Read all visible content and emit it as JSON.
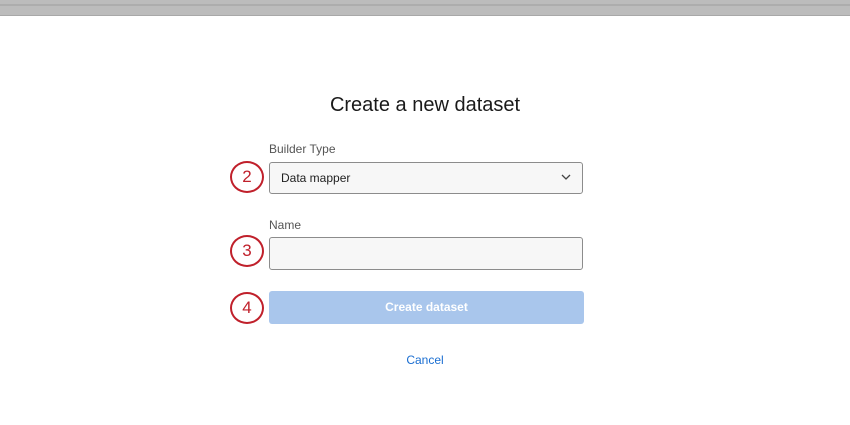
{
  "title": "Create a new dataset",
  "builder_type": {
    "label": "Builder Type",
    "value": "Data mapper",
    "marker": "2"
  },
  "name": {
    "label": "Name",
    "value": "",
    "marker": "3"
  },
  "create_button": {
    "label": "Create dataset",
    "marker": "4"
  },
  "cancel_label": "Cancel",
  "colors": {
    "marker": "#c0202b",
    "button_disabled": "#a9c6ec",
    "link": "#1a6ed1"
  }
}
